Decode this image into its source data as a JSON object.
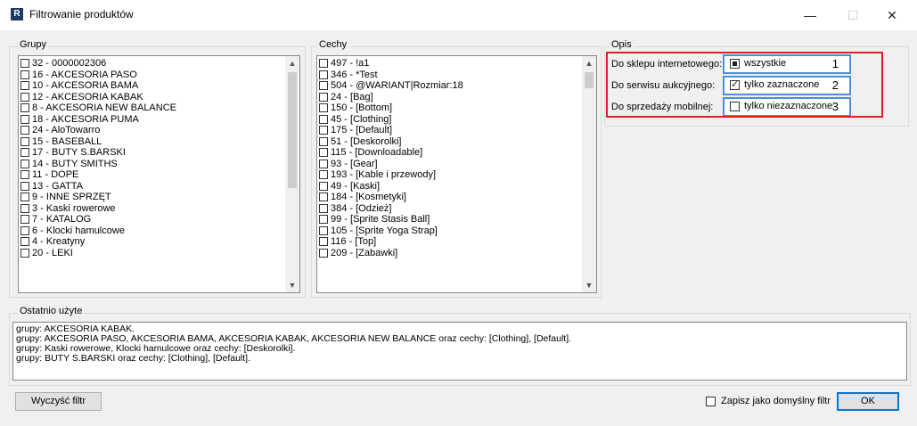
{
  "window": {
    "icon_letter": "R",
    "title": "Filtrowanie produktów",
    "minimize": "—",
    "maximize": "☐",
    "close": "✕"
  },
  "grupy": {
    "label": "Grupy",
    "items": [
      "32 - 0000002306",
      "16 - AKCESORIA  PASO",
      "10 - AKCESORIA BAMA",
      "12 - AKCESORIA KABAK",
      "8 - AKCESORIA NEW BALANCE",
      "18 - AKCESORIA PUMA",
      "24 - AloTowarro",
      "15 - BASEBALL",
      "17 - BUTY S.BARSKI",
      "14 - BUTY SMITHS",
      "11 - DOPE",
      "13 - GATTA",
      "9 - INNE SPRZĘT",
      "3 - Kaski rowerowe",
      "7 - KATALOG",
      "6 - Klocki hamulcowe",
      "4 - Kreatyny",
      "20 - LEKI"
    ]
  },
  "cechy": {
    "label": "Cechy",
    "items": [
      "497 - !a1",
      "346 - *Test",
      "504 - @WARIANT|Rozmiar:18",
      "24 - [Bag]",
      "150 - [Bottom]",
      "45 - [Clothing]",
      "175 - [Default]",
      "51 - [Deskorolki]",
      "115 - [Downloadable]",
      "93 - [Gear]",
      "193 - [Kable i przewody]",
      "49 - [Kaski]",
      "184 - [Kosmetyki]",
      "384 - [Odzież]",
      "99 - [Sprite Stasis Ball]",
      "105 - [Sprite Yoga Strap]",
      "116 - [Top]",
      "209 - [Zabawki]"
    ]
  },
  "opis": {
    "label": "Opis",
    "rows": [
      {
        "label": "Do sklepu internetowego:",
        "value": "wszystkie",
        "number": "1",
        "state": "indeterminate"
      },
      {
        "label": "Do serwisu aukcyjnego:",
        "value": "tylko zaznaczone",
        "number": "2",
        "state": "checked"
      },
      {
        "label": "Do sprzedaży mobilnej:",
        "value": "tylko niezaznaczone",
        "number": "3",
        "state": "unchecked"
      }
    ],
    "highlight_color": "#e11d2a",
    "focus_color": "#4a90e2"
  },
  "ostatnio": {
    "label": "Ostatnio użyte",
    "lines": [
      "grupy: AKCESORIA KABAK.",
      "grupy: AKCESORIA  PASO, AKCESORIA BAMA, AKCESORIA KABAK, AKCESORIA NEW BALANCE oraz cechy: [Clothing], [Default].",
      "grupy: Kaski rowerowe, Klocki hamulcowe oraz cechy: [Deskorolki].",
      "grupy: BUTY S.BARSKI oraz cechy: [Clothing], [Default]."
    ]
  },
  "footer": {
    "clear_label": "Wyczyść filtr",
    "save_default_label": "Zapisz jako domyślny filtr",
    "ok_label": "OK"
  }
}
